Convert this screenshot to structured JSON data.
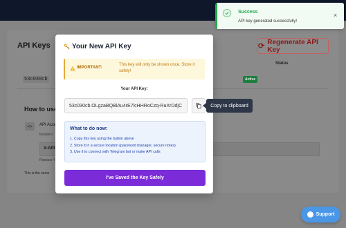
{
  "background": {
    "title": "API Keys",
    "regenerate_label": "Regenerate API Key",
    "status_header": "Status",
    "key_preview": "53c030cb",
    "status_badge": "Active",
    "how_to_title": "How to use",
    "api_access_label": "API Acce",
    "include_text": "Include t",
    "header_name": "X-API-",
    "replace_text": "Replace Y",
    "same_text": "This is the same"
  },
  "modal": {
    "title": "Your New API Key",
    "warning_strong": "IMPORTANT:",
    "warning_text": "This key will only be shown once. Store it safely!",
    "key_label": "Your API Key:",
    "key_value": "53c030cb.OLgzaBQBiAu4rE7lcHHRoCzq-RuXrDdjC",
    "todo_title": "What to do now:",
    "todo_items": [
      "1. Copy this key using the button above",
      "2. Store it in a secure location (password manager, secure notes)",
      "3. Use it to connect with Telegram bot or make API calls"
    ],
    "saved_button": "I've Saved the Key Safely"
  },
  "tooltip": {
    "text": "Copy to clipboard"
  },
  "toast": {
    "title": "Success",
    "message": "API key generated successfully!",
    "close_symbol": "×"
  },
  "support": {
    "label": "Support"
  },
  "colors": {
    "accent_purple": "#7b2bd8",
    "success_green": "#22a94c",
    "warning_amber": "#e2a93b",
    "support_blue": "#4a97e8",
    "topbar_dark": "#0f172a"
  }
}
